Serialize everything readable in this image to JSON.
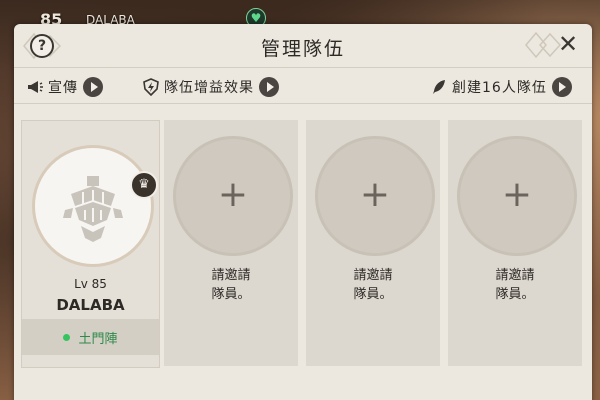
{
  "hud": {
    "level": "85",
    "name": "DALABA"
  },
  "panel": {
    "title": "管理隊伍",
    "help_label": "?",
    "close_label": "✕"
  },
  "toolbar": {
    "promote_label": "宣傳",
    "buff_label": "隊伍增益效果",
    "create_label": "創建16人隊伍"
  },
  "leader": {
    "level": "Lv 85",
    "name": "DALABA",
    "class_name": "土門陣",
    "crown_icon": "crown-icon"
  },
  "slots": [
    {
      "line1": "請邀請",
      "line2": "隊員。"
    },
    {
      "line1": "請邀請",
      "line2": "隊員。"
    },
    {
      "line1": "請邀請",
      "line2": "隊員。"
    }
  ],
  "colors": {
    "panel_bg": "#ece8e0",
    "accent_dark": "#4a4540",
    "online_green": "#35c45f"
  }
}
